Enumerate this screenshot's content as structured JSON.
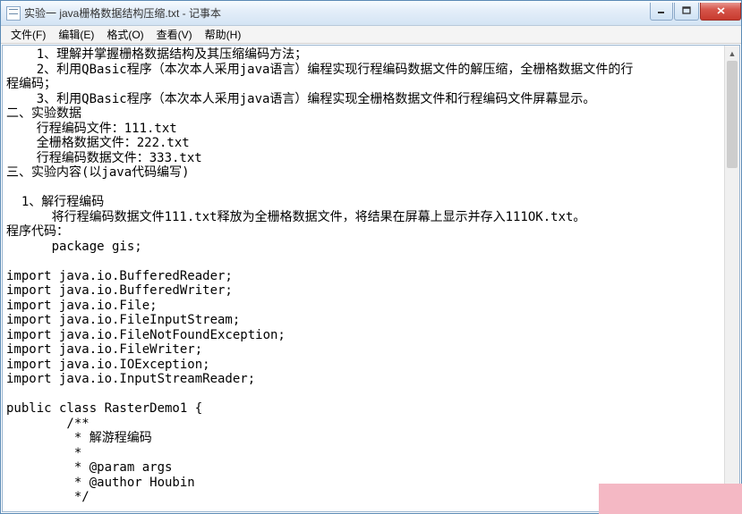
{
  "window": {
    "title": "实验一 java栅格数据结构压缩.txt - 记事本"
  },
  "menu": {
    "file": "文件(F)",
    "edit": "编辑(E)",
    "format": "格式(O)",
    "view": "查看(V)",
    "help": "帮助(H)"
  },
  "body": {
    "l1": "    1、理解并掌握栅格数据结构及其压缩编码方法；",
    "l2": "    2、利用QBasic程序（本次本人采用java语言）编程实现行程编码数据文件的解压缩，全栅格数据文件的行",
    "l3": "程编码；",
    "l4": "    3、利用QBasic程序（本次本人采用java语言）编程实现全栅格数据文件和行程编码文件屏幕显示。",
    "l5": "二、实验数据",
    "l6": "    行程编码文件：111.txt",
    "l7": "    全栅格数据文件：222.txt",
    "l8": "    行程编码数据文件：333.txt",
    "l9": "三、实验内容(以java代码编写)",
    "l10": "",
    "l11": "  1、解行程编码",
    "l12": "      将行程编码数据文件111.txt释放为全栅格数据文件，将结果在屏幕上显示并存入111OK.txt。",
    "l13": "程序代码：",
    "l14": "      package gis;",
    "l15": "",
    "l16": "import java.io.BufferedReader;",
    "l17": "import java.io.BufferedWriter;",
    "l18": "import java.io.File;",
    "l19": "import java.io.FileInputStream;",
    "l20": "import java.io.FileNotFoundException;",
    "l21": "import java.io.FileWriter;",
    "l22": "import java.io.IOException;",
    "l23": "import java.io.InputStreamReader;",
    "l24": "",
    "l25": "public class RasterDemo1 {",
    "l26": "        /**",
    "l27": "         * 解游程编码",
    "l28": "         * ",
    "l29": "         * @param args",
    "l30": "         * @author Houbin",
    "l31": "         */"
  }
}
